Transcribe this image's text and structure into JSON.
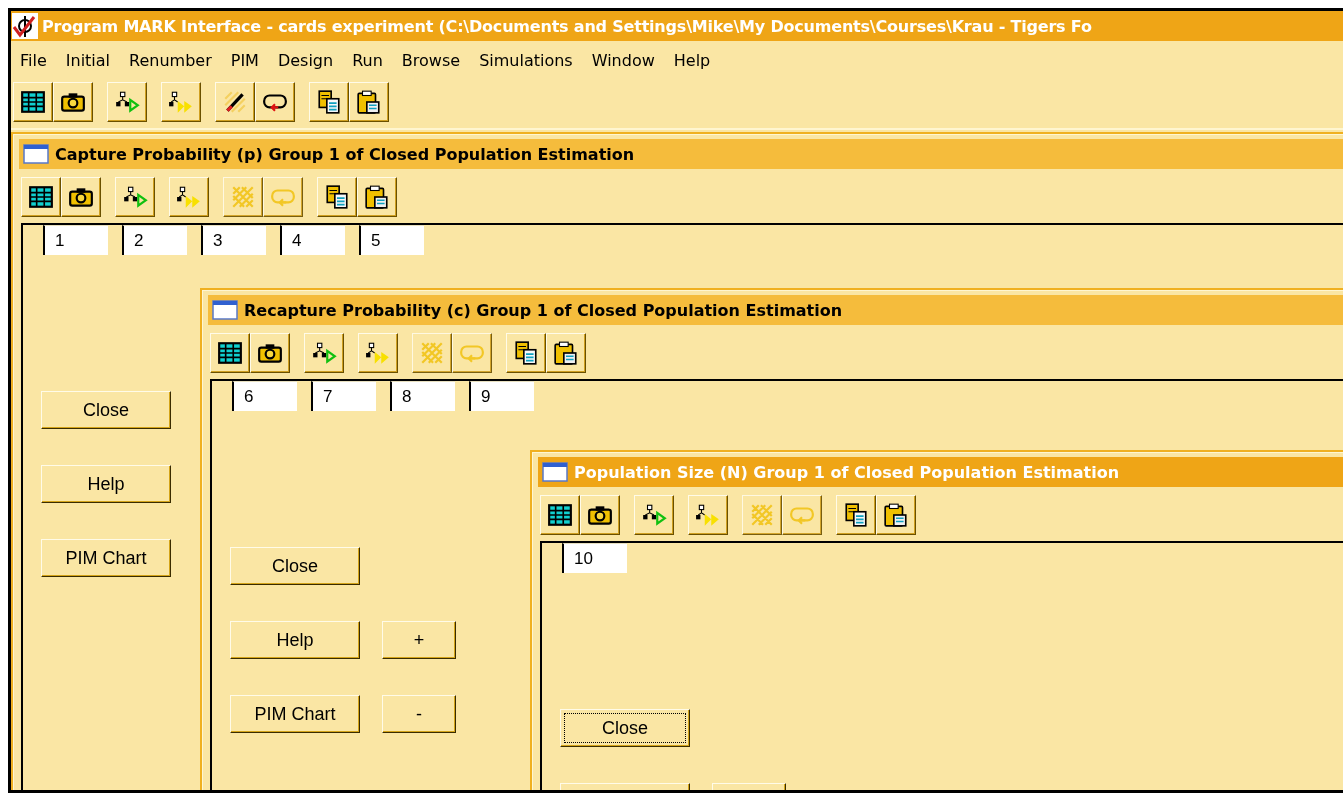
{
  "window": {
    "title": "Program MARK Interface - cards experiment  (C:\\Documents and Settings\\Mike\\My Documents\\Courses\\Krau - Tigers Fo"
  },
  "menu": [
    "File",
    "Initial",
    "Renumber",
    "PIM",
    "Design",
    "Run",
    "Browse",
    "Simulations",
    "Window",
    "Help"
  ],
  "toolbar": [
    [
      {
        "kind": "table",
        "disabled": false
      },
      {
        "kind": "camera",
        "disabled": false
      }
    ],
    [
      {
        "kind": "tree-run",
        "disabled": false
      }
    ],
    [
      {
        "kind": "tree-fast",
        "disabled": false
      }
    ],
    [
      {
        "kind": "pencil",
        "disabled": false
      },
      {
        "kind": "loop",
        "disabled": false
      }
    ],
    [
      {
        "kind": "copy",
        "disabled": false
      },
      {
        "kind": "paste",
        "disabled": false
      }
    ]
  ],
  "windows": [
    {
      "title": "Capture Probability (p) Group 1 of Closed Population Estimation",
      "active": false,
      "toolbar": [
        [
          {
            "kind": "table",
            "disabled": false
          },
          {
            "kind": "camera",
            "disabled": false
          }
        ],
        [
          {
            "kind": "tree-run",
            "disabled": false
          }
        ],
        [
          {
            "kind": "tree-fast",
            "disabled": false
          }
        ],
        [
          {
            "kind": "pencil",
            "disabled": true
          },
          {
            "kind": "loop",
            "disabled": true
          }
        ],
        [
          {
            "kind": "copy",
            "disabled": false
          },
          {
            "kind": "paste",
            "disabled": false
          }
        ]
      ],
      "cells": [
        "1",
        "2",
        "3",
        "4",
        "5"
      ],
      "button_rows": [
        [
          {
            "kind": "text",
            "label": "Close",
            "focused": false
          }
        ],
        [
          {
            "kind": "text",
            "label": "Help",
            "focused": false
          }
        ],
        [
          {
            "kind": "text",
            "label": "PIM Chart",
            "focused": false
          }
        ]
      ]
    },
    {
      "title": "Recapture Probability (c) Group 1 of Closed Population Estimation",
      "active": false,
      "toolbar": [
        [
          {
            "kind": "table",
            "disabled": false
          },
          {
            "kind": "camera",
            "disabled": false
          }
        ],
        [
          {
            "kind": "tree-run",
            "disabled": false
          }
        ],
        [
          {
            "kind": "tree-fast",
            "disabled": false
          }
        ],
        [
          {
            "kind": "pencil",
            "disabled": true
          },
          {
            "kind": "loop",
            "disabled": true
          }
        ],
        [
          {
            "kind": "copy",
            "disabled": false
          },
          {
            "kind": "paste",
            "disabled": false
          }
        ]
      ],
      "cells": [
        "6",
        "7",
        "8",
        "9"
      ],
      "button_rows": [
        [
          {
            "kind": "text",
            "label": "Close",
            "focused": false
          }
        ],
        [
          {
            "kind": "text",
            "label": "Help",
            "focused": false
          },
          {
            "kind": "small",
            "label": "+",
            "focused": false
          }
        ],
        [
          {
            "kind": "text",
            "label": "PIM Chart",
            "focused": false
          },
          {
            "kind": "small",
            "label": "-",
            "focused": false
          }
        ]
      ]
    },
    {
      "title": "Population Size (N) Group 1 of Closed Population Estimation",
      "active": true,
      "toolbar": [
        [
          {
            "kind": "table",
            "disabled": false
          },
          {
            "kind": "camera",
            "disabled": false
          }
        ],
        [
          {
            "kind": "tree-run",
            "disabled": false
          }
        ],
        [
          {
            "kind": "tree-fast",
            "disabled": false
          }
        ],
        [
          {
            "kind": "pencil",
            "disabled": true
          },
          {
            "kind": "loop",
            "disabled": true
          }
        ],
        [
          {
            "kind": "copy",
            "disabled": false
          },
          {
            "kind": "paste",
            "disabled": false
          }
        ]
      ],
      "cells": [
        "10"
      ],
      "button_rows": [
        [
          {
            "kind": "text",
            "label": "Close",
            "focused": true
          }
        ],
        [
          {
            "kind": "blank",
            "focused": false
          },
          {
            "kind": "blank-small",
            "focused": false
          }
        ]
      ]
    }
  ]
}
